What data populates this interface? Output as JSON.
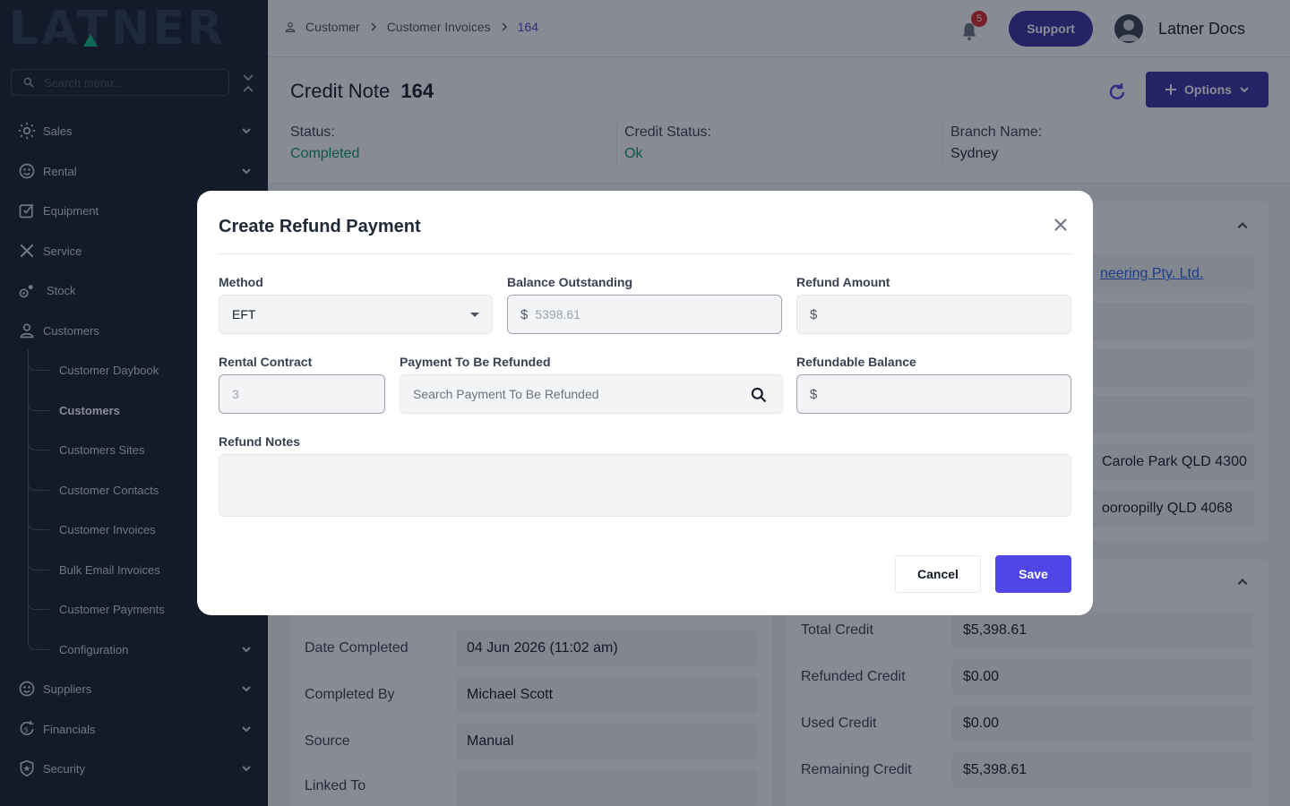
{
  "app": {
    "logo_text": "LATNER"
  },
  "sidebar": {
    "search_placeholder": "Search menu...",
    "items": [
      {
        "label": "Sales",
        "icon": "sun-icon"
      },
      {
        "label": "Rental",
        "icon": "rental-icon"
      },
      {
        "label": "Equipment",
        "icon": "equipment-icon"
      },
      {
        "label": "Service",
        "icon": "tools-icon"
      },
      {
        "label": "Stock",
        "icon": "stock-icon"
      },
      {
        "label": "Customers",
        "icon": "user-icon"
      },
      {
        "label": "Suppliers",
        "icon": "suppliers-icon"
      },
      {
        "label": "Financials",
        "icon": "financials-icon"
      },
      {
        "label": "Security",
        "icon": "shield-icon"
      }
    ],
    "customer_subitems": [
      "Customer Daybook",
      "Customers",
      "Customers Sites",
      "Customer Contacts",
      "Customer Invoices",
      "Bulk Email Invoices",
      "Customer Payments",
      "Configuration"
    ]
  },
  "topbar": {
    "breadcrumb": [
      "Customer",
      "Customer Invoices",
      "164"
    ],
    "notification_count": "5",
    "support_label": "Support",
    "user_name": "Latner Docs"
  },
  "page": {
    "title_prefix": "Credit Note",
    "title_number": "164",
    "options_label": "Options",
    "status_label": "Status:",
    "status_value": "Completed",
    "credit_status_label": "Credit Status:",
    "credit_status_value": "Ok",
    "branch_label": "Branch Name:",
    "branch_value": "Sydney"
  },
  "background": {
    "customer_link_partial": "neering Pty. Ltd.",
    "address_1_partial": "Carole Park QLD 4300",
    "address_2_partial": "ooroopilly QLD 4068",
    "date_completed_label": "Date Completed",
    "date_completed_value": "04 Jun 2026 (11:02 am)",
    "completed_by_label": "Completed By",
    "completed_by_value": "Michael Scott",
    "source_label": "Source",
    "source_value": "Manual",
    "linked_to_label": "Linked To",
    "total_credit_label": "Total Credit",
    "total_credit_value": "$5,398.61",
    "refunded_credit_label": "Refunded Credit",
    "refunded_credit_value": "$0.00",
    "used_credit_label": "Used Credit",
    "used_credit_value": "$0.00",
    "remaining_credit_label": "Remaining Credit",
    "remaining_credit_value": "$5,398.61"
  },
  "modal": {
    "title": "Create Refund Payment",
    "method_label": "Method",
    "method_value": "EFT",
    "balance_label": "Balance Outstanding",
    "currency_symbol": "$",
    "balance_value": "5398.61",
    "refund_amount_label": "Refund Amount",
    "rental_contract_label": "Rental Contract",
    "rental_contract_value": "3",
    "payment_label": "Payment To Be Refunded",
    "payment_placeholder": "Search Payment To Be Refunded",
    "refundable_label": "Refundable Balance",
    "notes_label": "Refund Notes",
    "cancel_label": "Cancel",
    "save_label": "Save"
  }
}
